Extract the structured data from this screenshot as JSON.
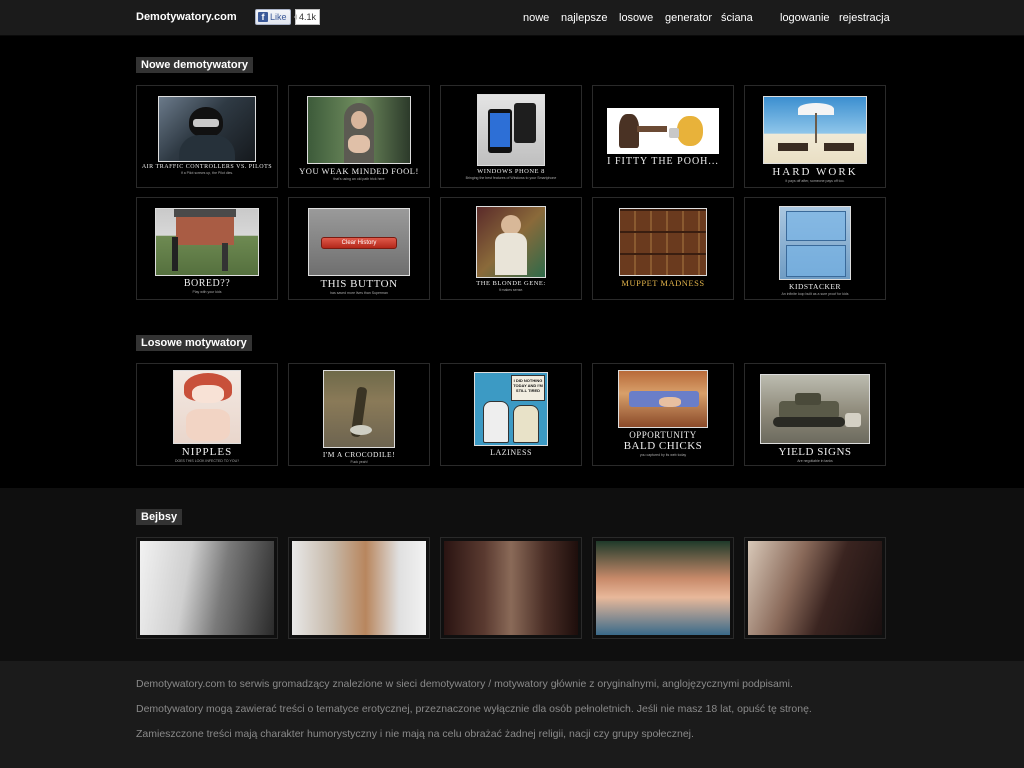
{
  "header": {
    "logo": "Demotywatory.com",
    "fb_like_label": "Like",
    "fb_like_count": "4.1k",
    "nav": [
      "nowe",
      "najlepsze",
      "losowe",
      "generator",
      "ściana",
      "logowanie",
      "rejestracja"
    ]
  },
  "sections": {
    "new_title": "Nowe demotywatory",
    "random_title": "Losowe motywatory",
    "babes_title": "Bejbsy"
  },
  "new_items": [
    {
      "caption": "AIR TRAFFIC CONTROLLERS VS. PILOTS",
      "sub": "If a Pilot screws up, the Pilot dies."
    },
    {
      "caption": "YOU WEAK MINDED FOOL!",
      "sub": "that's using an old path trick here"
    },
    {
      "caption": "WINDOWS PHONE 8",
      "sub": "Bringing the best features of Windows to your Smartphone"
    },
    {
      "caption": "I FITTY THE POOH...",
      "sub": ""
    },
    {
      "caption": "HARD WORK",
      "sub": "it pays off after, someone pays off too."
    },
    {
      "caption": "BORED??",
      "sub": "Play with your kids"
    },
    {
      "caption": "THIS BUTTON",
      "sub": "has saved more lives than Superman",
      "button_label": "Clear History"
    },
    {
      "caption": "THE BLONDE GENE:",
      "sub": "It makes sense."
    },
    {
      "caption": "MUPPET MADNESS",
      "sub": ""
    },
    {
      "caption": "KIDSTACKER",
      "sub": "An infinite loop built as a sure proof for kids"
    }
  ],
  "random_items": [
    {
      "caption": "NIPPLES",
      "sub": "DOES THIS LOOK INFECTED TO YOU?"
    },
    {
      "caption": "I'M A CROCODILE!",
      "sub": "Fuck yeah!"
    },
    {
      "caption": "LAZINESS",
      "sub": "",
      "speech": "I DID NOTHING TODAY AND I'M STILL TIRED"
    },
    {
      "caption": "OPPORTUNITY",
      "sub2": "BALD CHICKS",
      "sub": "you captured by its web today"
    },
    {
      "caption": "YIELD SIGNS",
      "sub": "Are negotiable in tanks"
    }
  ],
  "footer": {
    "line1": "Demotywatory.com to serwis gromadzący znalezione w sieci demotywatory / motywatory głównie z oryginalnymi, anglojęzycznymi podpisami.",
    "line2": "Demotywatory mogą zawierać treści o tematyce erotycznej, przeznaczone wyłącznie dla osób pełnoletnich. Jeśli nie masz 18 lat, opuść tę stronę.",
    "line3": "Zamieszczone treści mają charakter humorystyczny i nie mają na celu obrażać żadnej religii, nacji czy grupy społecznej."
  },
  "colors": {
    "background": "#000000",
    "header": "#1b1b1b",
    "section_label": "#333333",
    "babes_band": "#0f0f0f",
    "footer_text": "#8a8a8a"
  }
}
